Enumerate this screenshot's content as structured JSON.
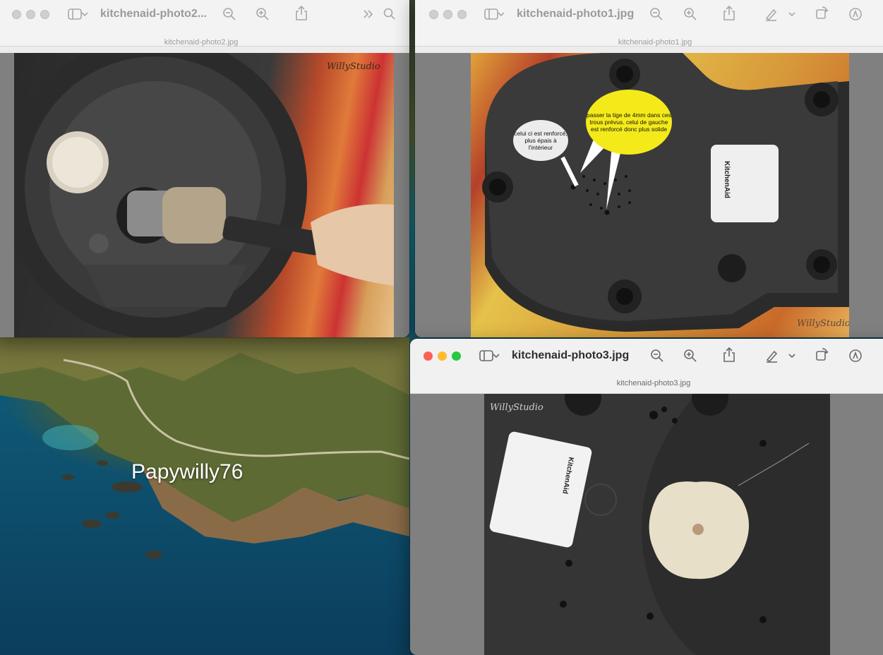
{
  "desktop": {
    "label": "Papywilly76"
  },
  "windows": {
    "photo2": {
      "title": "kitchenaid-photo2...",
      "subtitle": "kitchenaid-photo2.jpg",
      "watermark": "WillyStudio"
    },
    "photo1": {
      "title": "kitchenaid-photo1.jpg",
      "subtitle": "kitchenaid-photo1.jpg",
      "watermark": "WillyStudio",
      "bubble_left": "celui ci est renforcé, plus épais à l'intérieur",
      "bubble_right": "passer la tige de 4mm dans ces trous prévus. celui de gauche est renforcé donc plus solide",
      "label_brand": "KitchenAid"
    },
    "photo3": {
      "title": "kitchenaid-photo3.jpg",
      "subtitle": "kitchenaid-photo3.jpg",
      "watermark": "WillyStudio",
      "label_brand": "KitchenAid"
    }
  },
  "colors": {
    "accent_bubble": "#f4ea1a",
    "red": "#fe5f57",
    "yellow": "#febc2e",
    "green": "#28c840"
  },
  "icons": [
    "sidebar-icon",
    "chevron-down-icon",
    "zoom-out-icon",
    "zoom-in-icon",
    "share-icon",
    "markup-pen-icon",
    "rotate-icon",
    "annotate-icon",
    "search-icon",
    "more-chevron-icon"
  ]
}
